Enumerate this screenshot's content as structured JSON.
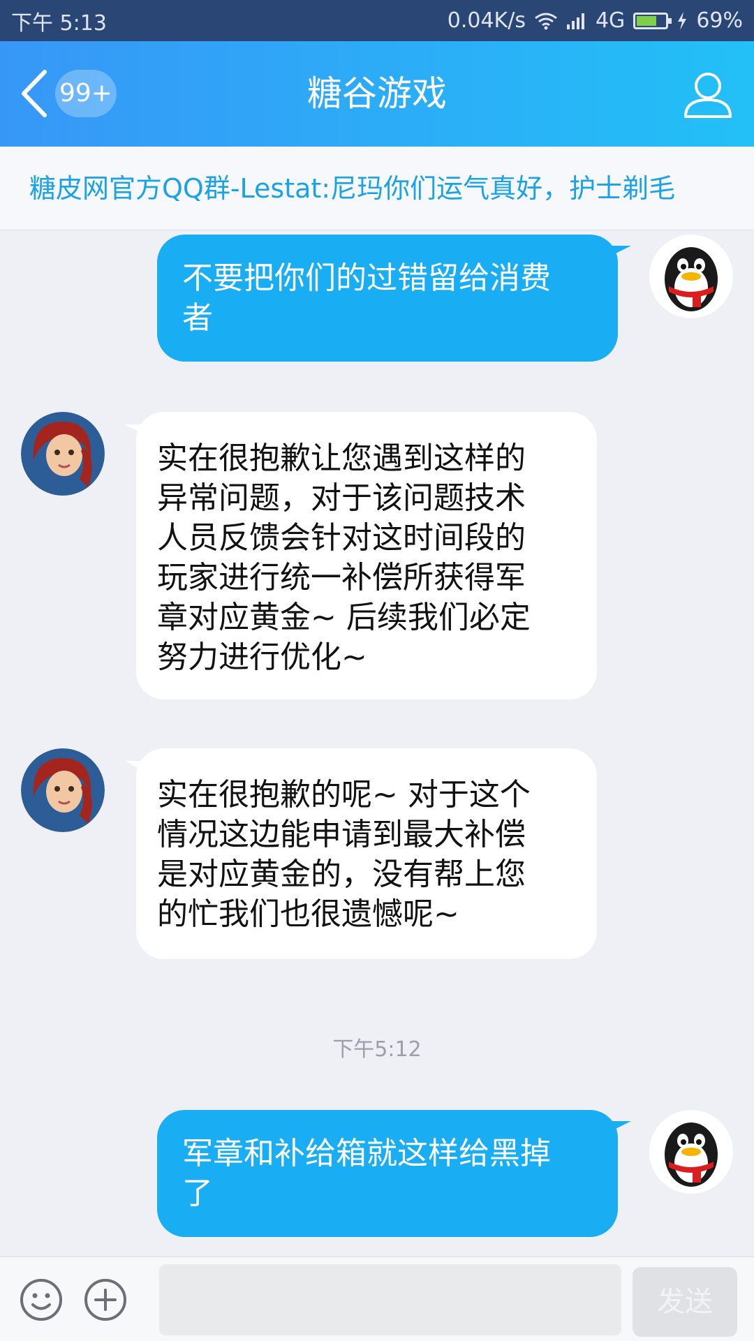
{
  "status_bar": {
    "time": "下午 5:13",
    "net_speed": "0.04K/s",
    "network": "4G",
    "battery_percent": "69%",
    "battery_level": 0.69
  },
  "header": {
    "unread_badge": "99+",
    "title": "糖谷游戏"
  },
  "notice": {
    "text": "糖皮网官方QQ群-Lestat:尼玛你们运气真好，护士剃毛"
  },
  "messages": [
    {
      "direction": "out",
      "lines": [
        "不要把你们的过错留给消费",
        "者"
      ]
    },
    {
      "direction": "in",
      "lines": [
        "实在很抱歉让您遇到这样的",
        "异常问题，对于该问题技术",
        "人员反馈会针对这时间段的",
        "玩家进行统一补偿所获得军",
        "章对应黄金~ 后续我们必定",
        "努力进行优化~"
      ]
    },
    {
      "direction": "in",
      "lines": [
        "实在很抱歉的呢~ 对于这个",
        "情况这边能申请到最大补偿",
        "是对应黄金的，没有帮上您",
        "的忙我们也很遗憾呢~"
      ]
    },
    {
      "timestamp": "下午5:12"
    },
    {
      "direction": "out",
      "lines": [
        "军章和补给箱就这样给黑掉",
        "了"
      ]
    }
  ],
  "input_bar": {
    "input_value": "",
    "send_label": "发送"
  },
  "colors": {
    "header_gradient_start": "#3797f7",
    "header_gradient_end": "#22c0f7",
    "outgoing_bubble": "#19adf3",
    "incoming_bubble": "#ffffff",
    "notice_text": "#1aa2e6"
  }
}
